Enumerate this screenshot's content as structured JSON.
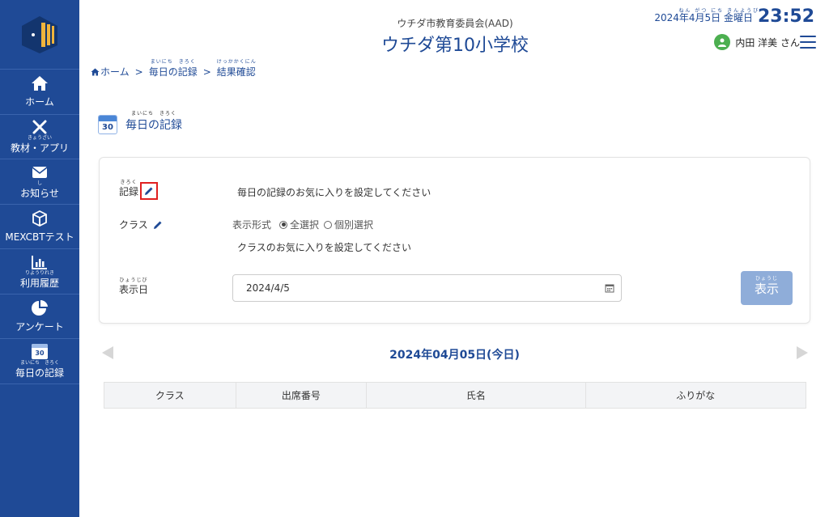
{
  "sidebar": {
    "items": [
      {
        "label": "ホーム",
        "ruby": ""
      },
      {
        "label": "教材・アプリ",
        "ruby": "きょうざい"
      },
      {
        "label": "お知らせ",
        "ruby": "し"
      },
      {
        "label": "MEXCBTテスト",
        "ruby": ""
      },
      {
        "label": "利用履歴",
        "ruby": "りようりれき"
      },
      {
        "label": "アンケート",
        "ruby": ""
      },
      {
        "label": "毎日の記録",
        "ruby": "まいにち　きろく"
      }
    ],
    "calendar_number": "30"
  },
  "header": {
    "org": "ウチダ市教育委員会(AAD)",
    "school": "ウチダ第10小学校",
    "date": "2024年4月5日 金曜日",
    "date_ruby": "ねん がつ にち きんようび",
    "time": "23:52",
    "user": "内田 洋美 さん"
  },
  "breadcrumb": {
    "home": "ホーム",
    "sep": ">",
    "daily": "毎日の記録",
    "daily_ruby": "まいにち　きろく",
    "result": "結果確認",
    "result_ruby": "けっかかくにん"
  },
  "page": {
    "title": "毎日の記録",
    "title_ruby": "まいにち　きろく",
    "calendar_number": "30"
  },
  "form": {
    "record_label": "記録",
    "record_ruby": "きろく",
    "record_text": "毎日の記録のお気に入りを設定してください",
    "class_label": "クラス",
    "display_format_label": "表示形式",
    "radio_all": "全選択",
    "radio_individual": "個別選択",
    "class_text": "クラスのお気に入りを設定してください",
    "date_label": "表示日",
    "date_ruby": "ひょうじび",
    "date_value": "2024/4/5",
    "show_button": "表示",
    "show_ruby": "ひょうじ"
  },
  "result": {
    "current_date": "2024年04月05日(今日)"
  },
  "table": {
    "headers": [
      "クラス",
      "出席番号",
      "氏名",
      "ふりがな"
    ]
  },
  "colors": {
    "brand": "#1f4a96",
    "highlight": "#e02020",
    "button_disabled": "#8fadd9"
  }
}
